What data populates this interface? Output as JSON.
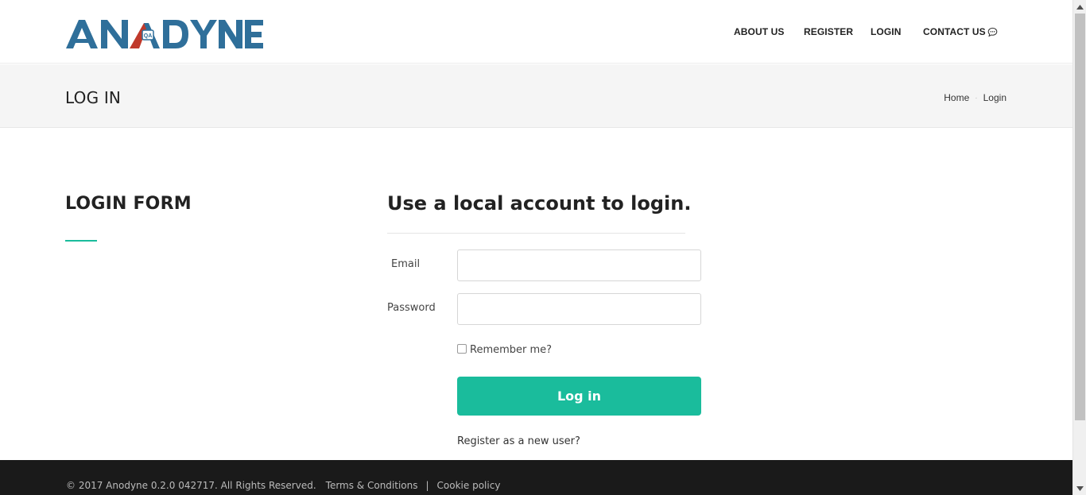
{
  "colors": {
    "accent": "#1abc9c",
    "logo_blue": "#2f6f9a",
    "logo_red": "#c0392b",
    "footer_bg": "#1a1a1a",
    "titlebar_bg": "#f5f5f5"
  },
  "brand": {
    "logo_text": "ANADYNE"
  },
  "nav": {
    "items": [
      {
        "label": "ABOUT US"
      },
      {
        "label": "REGISTER"
      },
      {
        "label": "LOGIN"
      },
      {
        "label": "CONTACT US",
        "icon": "chat-icon"
      }
    ]
  },
  "titlebar": {
    "title": "LOG IN",
    "breadcrumb": [
      {
        "label": "Home"
      },
      {
        "label": "Login"
      }
    ]
  },
  "main": {
    "section_heading": "LOGIN FORM",
    "form_heading": "Use a local account to login.",
    "email_label": "Email",
    "email_value": "",
    "password_label": "Password",
    "password_value": "",
    "remember_label": "Remember me?",
    "remember_checked": false,
    "login_button": "Log in",
    "register_link": "Register as a new user?"
  },
  "footer": {
    "copyright": "© 2017 Anodyne 0.2.0 042717. All Rights Reserved.",
    "links": [
      {
        "label": "Terms & Conditions"
      },
      {
        "label": "Cookie policy"
      }
    ],
    "separator": "|"
  },
  "icons": [
    "chat-icon",
    "chevron-up-icon",
    "chevron-down-icon"
  ]
}
